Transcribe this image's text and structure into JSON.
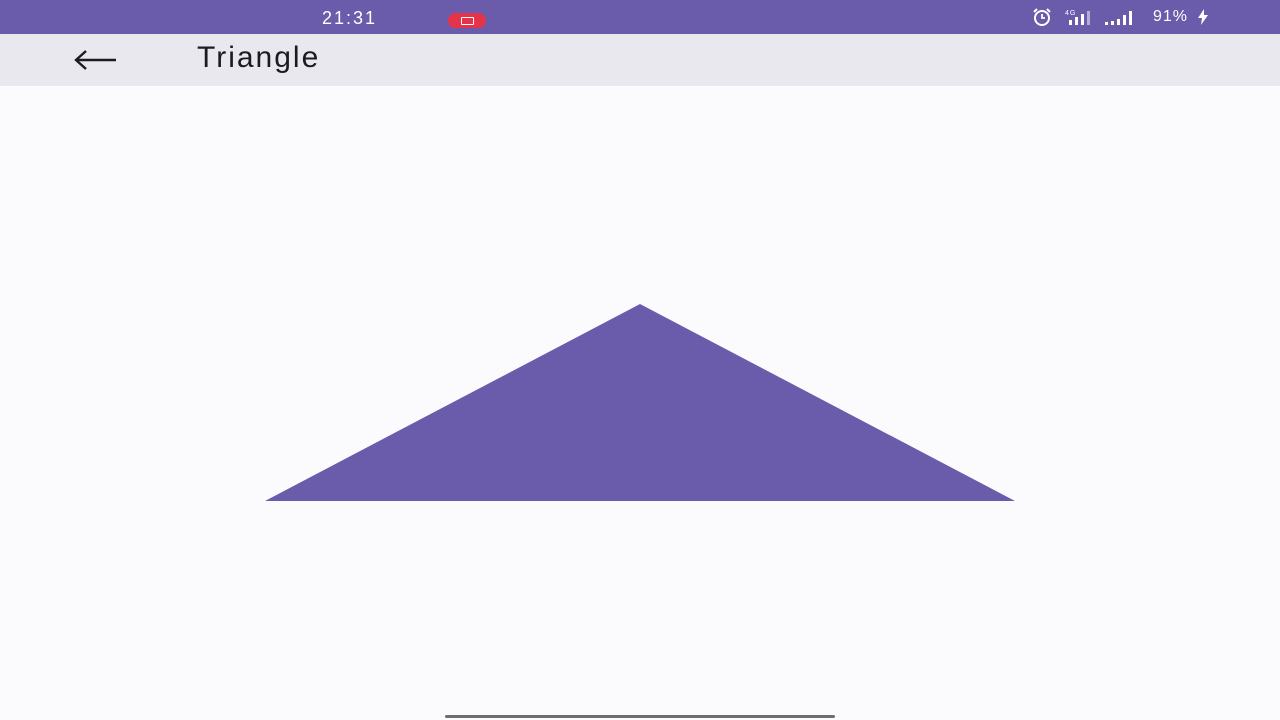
{
  "status_bar": {
    "time": "21:31",
    "battery": "91%",
    "network": "4G",
    "background_color": "#6a5bab",
    "icons": [
      "screen-record-icon",
      "alarm-icon",
      "signal-icon",
      "battery-charging-icon"
    ]
  },
  "app_bar": {
    "title": "Triangle",
    "back_icon": "arrow-left-icon",
    "background_color": "#eae8ef"
  },
  "content": {
    "shape": "triangle",
    "fill_color": "#6a5bab"
  }
}
